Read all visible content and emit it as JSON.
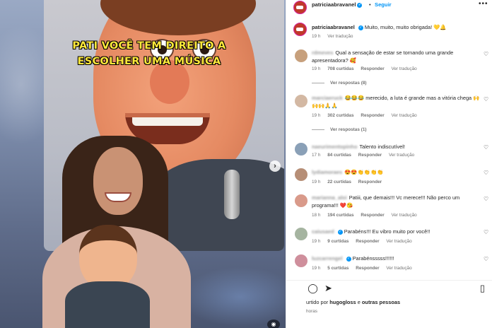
{
  "media": {
    "overlay_line1": "PATI VOCÊ TEM DIREITO A",
    "overlay_line2": "ESCOLHER UMA MÚSICA",
    "next_icon": "chevron-right-icon"
  },
  "post": {
    "username": "patriciaabravanel",
    "follow_label": "Seguir",
    "separator": "•",
    "caption": "Muito, muito, muito obrigada! 💛🔔",
    "caption_time": "19 h",
    "caption_translate": "Ver tradução"
  },
  "comments": [
    {
      "user": "rdmeves",
      "text": "Qual a sensação de estar se tornando uma grande apresentadora? 🥰",
      "time": "19 h",
      "likes": "708 curtidas",
      "reply": "Responder",
      "translate": "Ver tradução",
      "replies": "Ver respostas (8)"
    },
    {
      "user": "marciaeruck",
      "text": "😂😂😂 merecido, a luta é grande mas a vitória chega 🙌🙌🙌🙏🙏",
      "time": "19 h",
      "likes": "302 curtidas",
      "reply": "Responder",
      "translate": "Ver tradução",
      "replies": "Ver respostas (1)"
    },
    {
      "user": "naeurimentopinho",
      "text": "Talento indiscutível!",
      "time": "17 h",
      "likes": "84 curtidas",
      "reply": "Responder",
      "translate": "Ver tradução"
    },
    {
      "user": "lydiamoraes",
      "text": "😍😍👏👏👏👏",
      "time": "19 h",
      "likes": "22 curtidas",
      "reply": "Responder",
      "translate": ""
    },
    {
      "user": "marianna_aloi",
      "text": "Patiii, que demais!!! Vc merece!!! Não perco um programa!!! ❤️😘",
      "time": "18 h",
      "likes": "194 curtidas",
      "reply": "Responder",
      "translate": "Ver tradução"
    },
    {
      "user": "caiusaed",
      "text": "Parabéns!!! Eu vibro muito por você!!",
      "time": "19 h",
      "likes": "9 curtidas",
      "reply": "Responder",
      "translate": "Ver tradução"
    },
    {
      "user": "luzcarrengel",
      "text": "Parabénsssss!!!!!!",
      "time": "19 h",
      "likes": "5 curtidas",
      "reply": "Responder",
      "translate": "Ver tradução"
    }
  ],
  "footer": {
    "liked_prefix": "urtido por",
    "liked_user": "hugogloss",
    "liked_mid": "e",
    "liked_others": "outras pessoas",
    "time": "horas"
  },
  "icons": {
    "heart": "heart-icon",
    "comment": "comment-icon",
    "share": "share-icon",
    "save": "bookmark-icon",
    "more": "more-options-icon"
  },
  "colors": {
    "accent": "#0095f6",
    "overlay_text": "#ffe93a",
    "muted": "#737373"
  }
}
